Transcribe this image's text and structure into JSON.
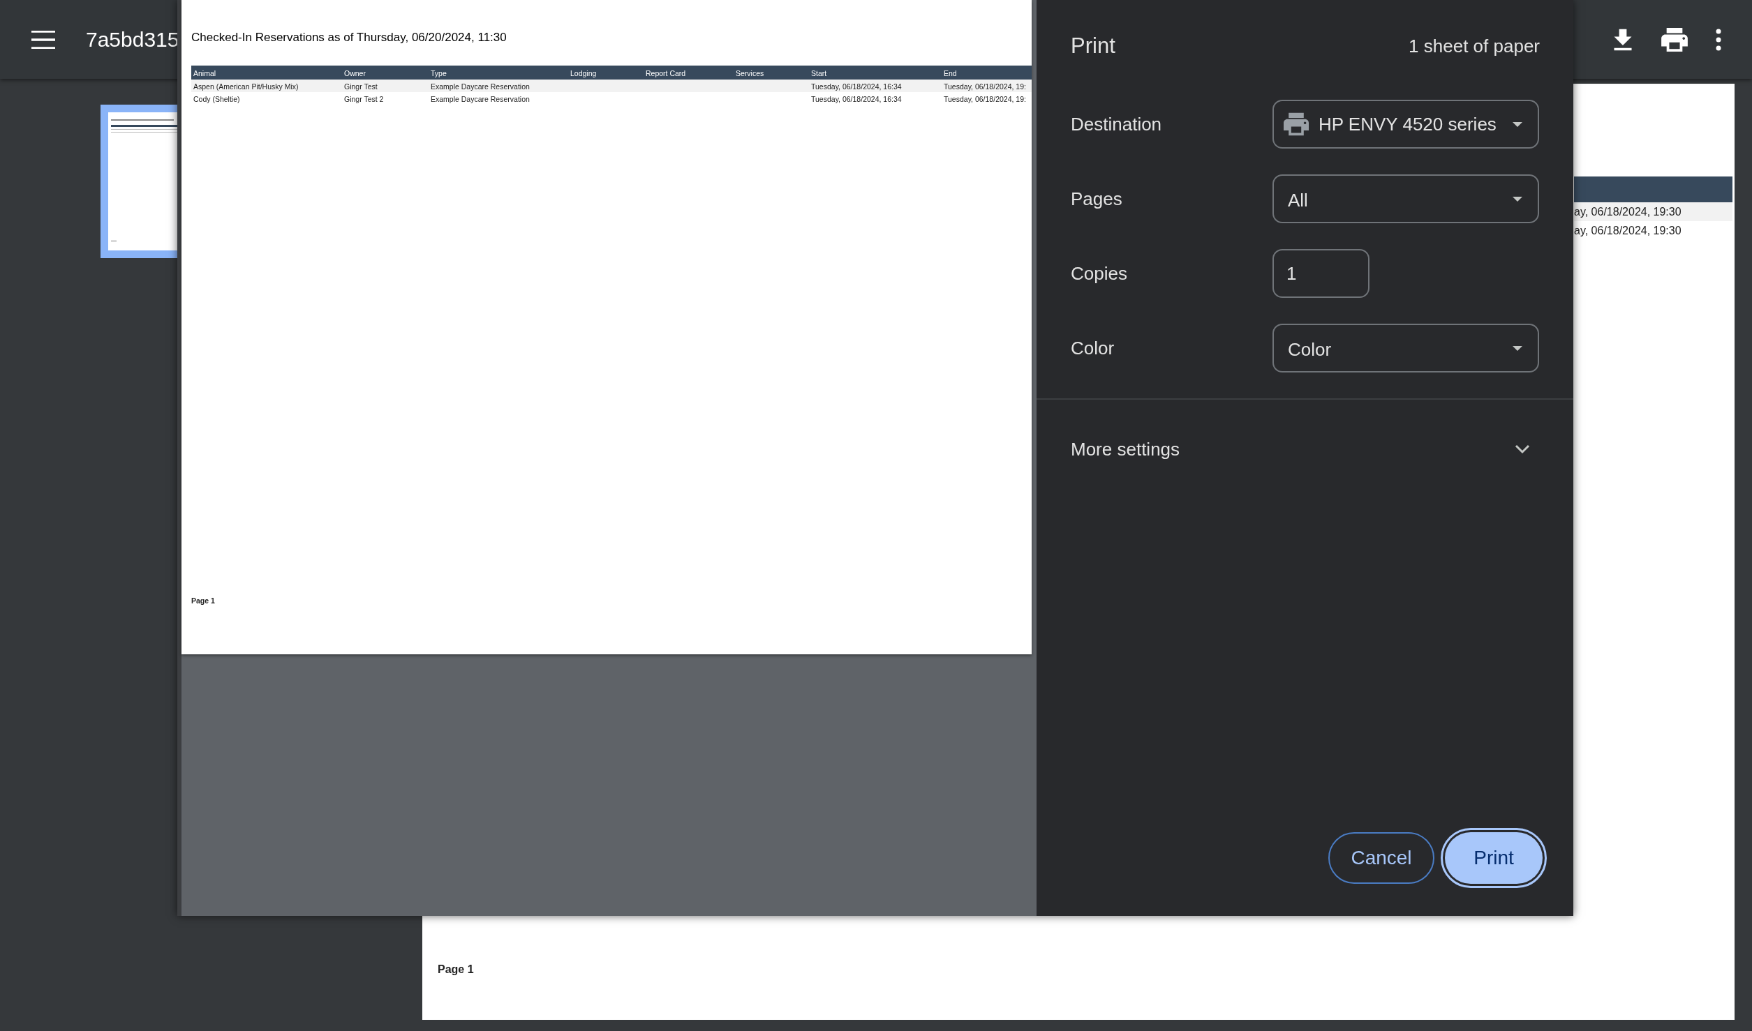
{
  "viewer": {
    "title": "7a5bd315",
    "page": {
      "visible_cells": [
        "ay, 06/18/2024, 19:30",
        "ay, 06/18/2024, 19:30"
      ],
      "footer": "Page 1"
    }
  },
  "print_dialog": {
    "preview": {
      "title": "Checked-In Reservations as of Thursday, 06/20/2024, 11:30",
      "columns": [
        {
          "label": "Animal",
          "cells": [
            "Aspen (American Pit/Husky Mix)",
            "Cody (Sheltie)"
          ]
        },
        {
          "label": "Owner",
          "cells": [
            "Gingr Test",
            "Gingr Test 2"
          ]
        },
        {
          "label": "Type",
          "cells": [
            "Example Daycare Reservation",
            "Example Daycare Reservation"
          ]
        },
        {
          "label": "Lodging"
        },
        {
          "label": "Report Card"
        },
        {
          "label": "Services"
        },
        {
          "label": "Start",
          "cells": [
            "Tuesday, 06/18/2024, 16:34",
            "Tuesday, 06/18/2024, 16:34"
          ]
        },
        {
          "label": "End",
          "cells": [
            "Tuesday, 06/18/2024, 19:",
            "Tuesday, 06/18/2024, 19:"
          ]
        }
      ],
      "footer": "Page 1"
    },
    "title": "Print",
    "sheet_count": "1 sheet of paper",
    "settings": [
      {
        "kind": "destination",
        "label": "Destination",
        "value": "HP ENVY 4520 series"
      },
      {
        "kind": "select",
        "label": "Pages",
        "value": "All"
      },
      {
        "kind": "number",
        "label": "Copies",
        "value": "1"
      },
      {
        "kind": "select",
        "label": "Color",
        "value": "Color"
      }
    ],
    "more_settings": {
      "label": "More settings",
      "expanded": false
    },
    "buttons": [
      {
        "kind": "secondary",
        "label": "Cancel"
      },
      {
        "kind": "primary",
        "label": "Print"
      }
    ]
  }
}
